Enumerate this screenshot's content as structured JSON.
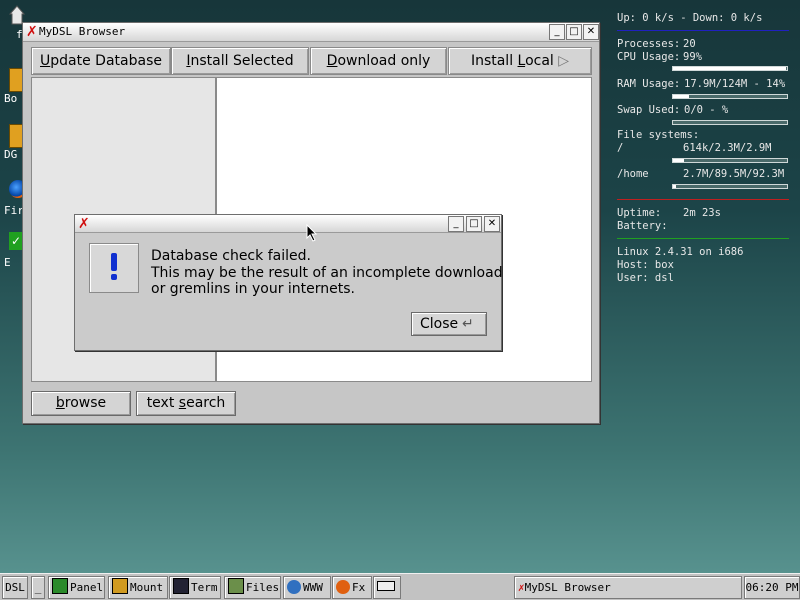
{
  "desktop": {
    "icons": [
      {
        "label": "f"
      },
      {
        "label": "Bo"
      },
      {
        "label": "DG"
      },
      {
        "label": "Fir"
      },
      {
        "label": "E"
      }
    ]
  },
  "monitor": {
    "net": "Up: 0 k/s - Down: 0 k/s",
    "processes_label": "Processes:",
    "processes_value": "20",
    "cpu_label": "CPU Usage:",
    "cpu_value": "99%",
    "cpu_fraction": 0.99,
    "ram_label": "RAM Usage:",
    "ram_value": "17.9M/124M - 14%",
    "ram_fraction": 0.14,
    "swap_label": "Swap Used:",
    "swap_value": "0/0 - %",
    "swap_fraction": 0,
    "fs_label": "File systems:",
    "fs_root_label": "/",
    "fs_root_value": "614k/2.3M/2.9M",
    "fs_root_fraction": 0.1,
    "fs_home_label": "/home",
    "fs_home_value": "2.7M/89.5M/92.3M",
    "fs_home_fraction": 0.03,
    "uptime_label": "Uptime:",
    "uptime_value": "2m 23s",
    "battery_label": "Battery:",
    "linux": "Linux 2.4.31 on i686",
    "host": "Host: box",
    "user": "User: dsl",
    "colors": {
      "accent_red": "#c02020",
      "accent_blue": "#2020c0",
      "accent_green": "#20a020"
    }
  },
  "window": {
    "title": "MyDSL Browser",
    "toolbar": {
      "update_pre": "",
      "update_key": "U",
      "update_post": "pdate Database",
      "install_pre": "",
      "install_key": "I",
      "install_post": "nstall Selected",
      "download_pre": "",
      "download_key": "D",
      "download_post": "ownload only",
      "local_pre": "Install ",
      "local_key": "L",
      "local_post": "ocal"
    },
    "bottom": {
      "browse_pre": "",
      "browse_key": "b",
      "browse_post": "rowse",
      "search_pre": "text ",
      "search_key": "s",
      "search_post": "earch"
    }
  },
  "dialog": {
    "message": "Database check failed.\nThis may be the result of an incomplete download\nor gremlins in your internets.",
    "close_label": "Close"
  },
  "taskbar": {
    "start": "DSL",
    "minimize": "_",
    "panel": "Panel",
    "mount": "Mount",
    "term": "Term",
    "files": "Files",
    "www": "WWW",
    "fx": "Fx",
    "task_title": "MyDSL Browser",
    "clock": "06:20 PM"
  }
}
